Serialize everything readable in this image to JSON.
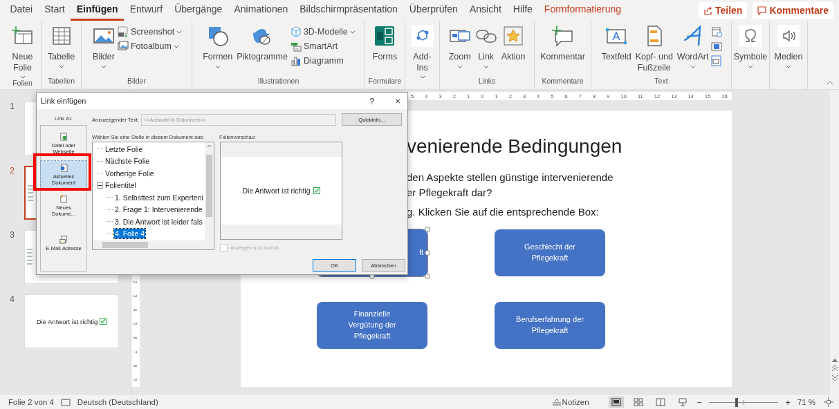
{
  "tabs": [
    {
      "label": "Datei",
      "selected": false,
      "kind": "main"
    },
    {
      "label": "Start",
      "selected": false,
      "kind": "main"
    },
    {
      "label": "Einfügen",
      "selected": true,
      "kind": "main"
    },
    {
      "label": "Entwurf",
      "selected": false,
      "kind": "main"
    },
    {
      "label": "Übergänge",
      "selected": false,
      "kind": "main"
    },
    {
      "label": "Animationen",
      "selected": false,
      "kind": "main"
    },
    {
      "label": "Bildschirmpräsentation",
      "selected": false,
      "kind": "main"
    },
    {
      "label": "Überprüfen",
      "selected": false,
      "kind": "main"
    },
    {
      "label": "Ansicht",
      "selected": false,
      "kind": "main"
    },
    {
      "label": "Hilfe",
      "selected": false,
      "kind": "main"
    },
    {
      "label": "Formformatierung",
      "selected": false,
      "kind": "contextual"
    }
  ],
  "share_button": "Teilen",
  "comments_button": "Kommentare",
  "ribbon_groups": [
    {
      "label": "Folien",
      "commands": [
        {
          "label": "Neue\nFolie",
          "kind": "large",
          "dropdown": true
        }
      ]
    },
    {
      "label": "Tabellen",
      "commands": [
        {
          "label": "Tabelle",
          "kind": "large",
          "dropdown": true
        }
      ]
    },
    {
      "label": "Bilder",
      "commands": [
        {
          "label": "Bilder",
          "kind": "large",
          "dropdown": true
        },
        {
          "label": "Screenshot",
          "kind": "small",
          "dropdown": true
        },
        {
          "label": "Fotoalbum",
          "kind": "small",
          "dropdown": true
        }
      ]
    },
    {
      "label": "Illustrationen",
      "commands": [
        {
          "label": "Formen",
          "kind": "large",
          "dropdown": true
        },
        {
          "label": "Piktogramme",
          "kind": "large",
          "dropdown": false
        },
        {
          "label": "3D-Modelle",
          "kind": "small",
          "dropdown": true
        },
        {
          "label": "SmartArt",
          "kind": "small",
          "dropdown": false
        },
        {
          "label": "Diagramm",
          "kind": "small",
          "dropdown": false
        }
      ]
    },
    {
      "label": "Formulare",
      "commands": [
        {
          "label": "Forms",
          "kind": "large",
          "dropdown": false
        }
      ]
    },
    {
      "commands": [
        {
          "label": "Add-\nIns",
          "kind": "large",
          "dropdown": true
        }
      ]
    },
    {
      "label": "Links",
      "commands": [
        {
          "label": "Zoom",
          "kind": "large",
          "dropdown": true
        },
        {
          "label": "Link",
          "kind": "large",
          "dropdown": true
        },
        {
          "label": "Aktion",
          "kind": "large",
          "dropdown": false
        }
      ]
    },
    {
      "label": "Kommentare",
      "commands": [
        {
          "label": "Kommentar",
          "kind": "large",
          "dropdown": false
        }
      ]
    },
    {
      "label": "Text",
      "commands": [
        {
          "label": "Textfeld",
          "kind": "large",
          "dropdown": false
        },
        {
          "label": "Kopf- und\nFußzeile",
          "kind": "large",
          "dropdown": false
        },
        {
          "label": "WordArt",
          "kind": "large",
          "dropdown": true
        },
        {
          "kind": "icon"
        },
        {
          "kind": "icon"
        },
        {
          "kind": "icon"
        }
      ]
    },
    {
      "commands": [
        {
          "label": "Symbole",
          "kind": "large",
          "dropdown": true
        }
      ]
    },
    {
      "commands": [
        {
          "label": "Medien",
          "kind": "large",
          "dropdown": true
        }
      ]
    }
  ],
  "slides": [
    {
      "number": "1",
      "selected": false
    },
    {
      "number": "2",
      "selected": true
    },
    {
      "number": "3",
      "selected": false
    },
    {
      "number": "4",
      "selected": false,
      "text": "Die Antwort ist richtig"
    }
  ],
  "ruler_labels": [
    "5",
    "4",
    "3",
    "2",
    "1",
    "0",
    "1",
    "2",
    "3",
    "4",
    "5",
    "6",
    "7",
    "8",
    "9",
    "10",
    "11",
    "12",
    "13",
    "14",
    "15",
    "16"
  ],
  "vertical_ruler_labels": [
    "2",
    "3",
    "4",
    "5",
    "6",
    "7",
    "8",
    "9"
  ],
  "slide": {
    "title": "venierende Bedingungen",
    "question_lines": [
      "den Aspekte stellen günstige intervenierende",
      "er Pflegekraft dar?"
    ],
    "instruction": "g. Klicken Sie auf die entsprechende Box:",
    "boxes": [
      {
        "text": "ft",
        "selected": true
      },
      {
        "text": "Geschlecht der Pflegekraft",
        "selected": false
      },
      {
        "text": "Finanzielle Vergütung der Pflegekraft",
        "selected": false
      },
      {
        "text": "Berufserfahrung der Pflegekraft",
        "selected": false
      }
    ]
  },
  "dialog": {
    "title": "Link einfügen",
    "help": "?",
    "close": "×",
    "link_to_label": "Link zu:",
    "nav": [
      {
        "label": "Datei oder\nWebseite",
        "selected": false
      },
      {
        "label": "Aktuelles\nDokument",
        "selected": true
      },
      {
        "label": "Neues\nDokume...",
        "selected": false
      },
      {
        "label": "E-Mail-Adresse",
        "selected": false
      }
    ],
    "display_text": {
      "label": "Anzuzeigender Text:",
      "value": "<<Auswahl in Dokument>>",
      "disabled": true
    },
    "quickinfo_button": "QuickInfo...",
    "place_label": "Wählen Sie eine Stelle in diesem Dokument aus:",
    "tree": [
      {
        "label": "Letzte Folie",
        "selected": false
      },
      {
        "label": "Nächste Folie",
        "selected": false
      },
      {
        "label": "Vorherige Folie",
        "selected": false
      },
      {
        "label": "Folientitel",
        "selected": false,
        "expanded": true,
        "children": [
          {
            "label": "1. Selbsttest zum Experteni",
            "selected": false
          },
          {
            "label": "2. Frage 1: Intervenierende",
            "selected": false
          },
          {
            "label": "3. Die Antwort ist leider fals",
            "selected": false
          },
          {
            "label": "4. Folie 4",
            "selected": true
          }
        ]
      }
    ],
    "preview_label": "Folienvorschau:",
    "preview_text": "Die Antwort ist richtig",
    "show_and_return": {
      "label": "Anzeigen und zurück",
      "checked": false,
      "disabled": true
    },
    "ok_button": "OK",
    "cancel_button": "Abbrechen"
  },
  "status_bar": {
    "slide_info": "Folie 2 von 4",
    "language": "Deutsch (Deutschland)",
    "notes": "Notizen",
    "zoom_out": "−",
    "zoom_in": "+",
    "zoom": {
      "level": 0.38
    },
    "zoom_percent": "71 %"
  }
}
